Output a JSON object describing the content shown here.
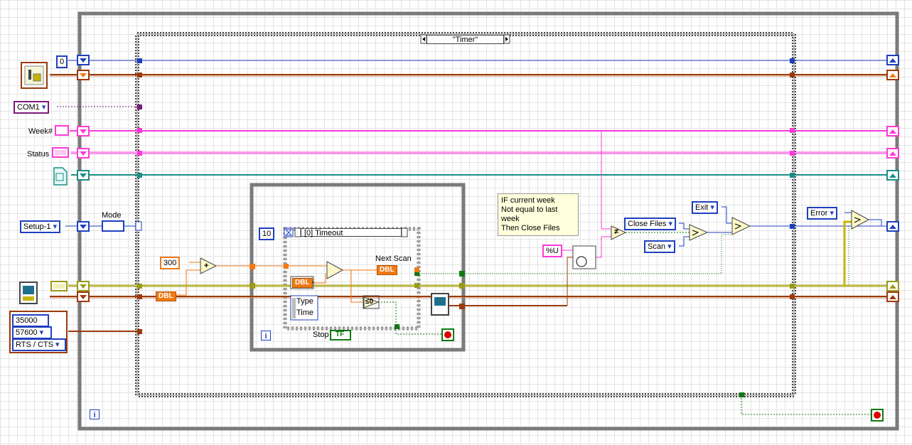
{
  "case_structure": {
    "selector_label": "\"Timer\"",
    "inner_case_label": "[0] Timeout"
  },
  "constants": {
    "index_value": "0",
    "com_port": "COM1",
    "setup": "Setup-1",
    "timeout_increment": "300",
    "timeout_ms": "10",
    "baud_timeout": "35000",
    "baud_rate": "57600",
    "flow_control": "RTS / CTS",
    "format_string": "%U",
    "close_files": "Close Files",
    "scan": "Scan",
    "exit": "Exit",
    "error": "Error"
  },
  "labels": {
    "mode": "Mode",
    "week": "Week#",
    "status": "Status",
    "next_scan": "Next Scan",
    "stop": "Stop",
    "dbl_out": "DBL",
    "dbl_in": "DBL",
    "dbl_clock": "DBL",
    "type": "Type",
    "time": "Time",
    "bool_tf": "TF",
    "iter_inner": "i",
    "iter_outer": "i",
    "not_equal": "≠",
    "add": "+",
    "compare": "≤0"
  },
  "comment": {
    "line1": "IF current week",
    "line2": "Not equal to last week",
    "line3": "Then Close Files"
  },
  "colors": {
    "int_wire": "#1f3fbf",
    "ref_wire": "#9b3a0b",
    "visa_wire": "#7a1a7a",
    "string_wire": "#ff3ad9",
    "path_wire": "#1a8e86",
    "float_wire": "#f07a14",
    "cluster_wire": "#9a9a1a",
    "bool_wire": "#0f7a0f",
    "error_wire": "#c8b400",
    "structure_frame": "#7a7a7a"
  }
}
